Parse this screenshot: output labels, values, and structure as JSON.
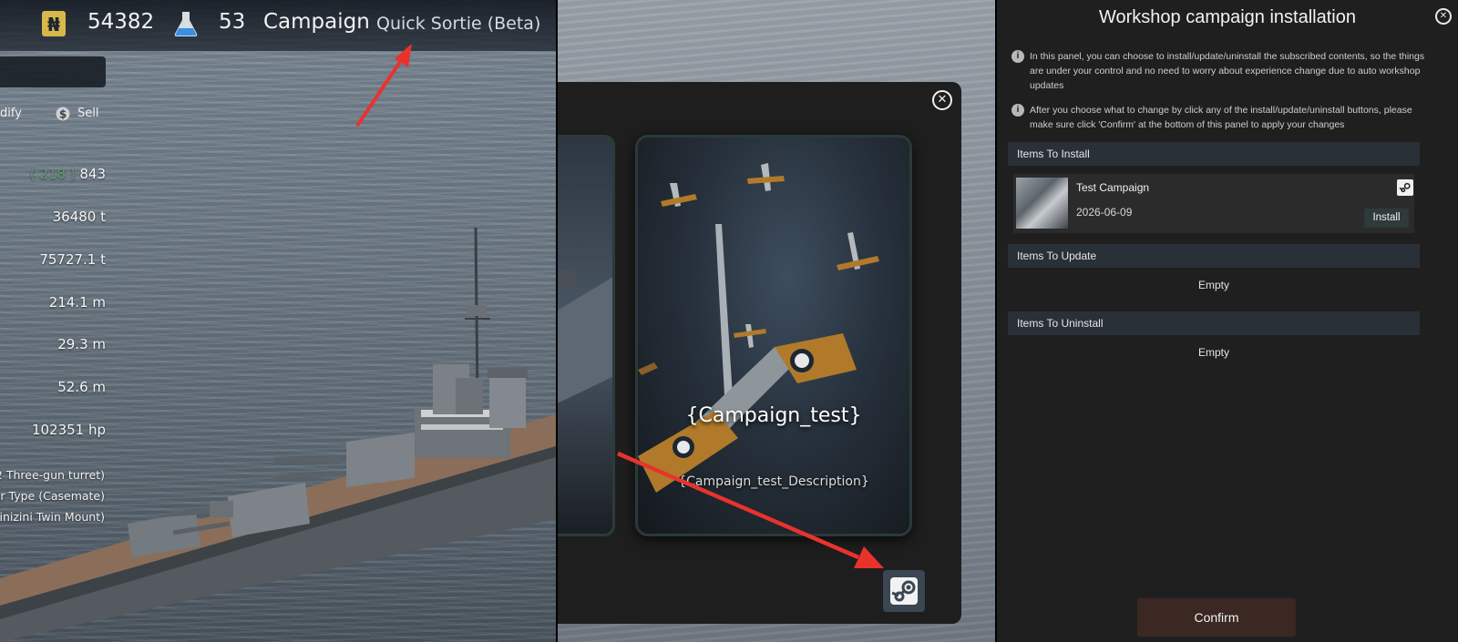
{
  "port": {
    "currency_value": "54382",
    "research_value": "53",
    "campaign_label": "Campaign",
    "quick_sortie_label": "Quick Sortie (Beta)",
    "modify_label": "dify",
    "sell_label": "Sell",
    "stats": {
      "bonus": "( 218 )",
      "s1": "843",
      "s2": "36480 t",
      "s3": "75727.1 t",
      "s4": "214.1 m",
      "s5": "29.3 m",
      "s6": "52.6 m",
      "s7": "102351 hp"
    },
    "weapons": [
      "2 Three-gun turret)",
      "ar Type (Casemate)",
      "inizini Twin Mount)"
    ]
  },
  "campaign_select": {
    "card_title": "{Campaign_test}",
    "card_description": "{Campaign_test_Description}"
  },
  "workshop": {
    "title": "Workshop campaign installation",
    "info_1": "In this panel, you can choose to install/update/uninstall the subscribed contents, so the things are under your control and no need to worry about experience change due to auto workshop updates",
    "info_2": "After you choose what to change by click any of the install/update/uninstall buttons, please make sure click 'Confirm' at the bottom of this panel to apply your changes",
    "sections": {
      "install": "Items To Install",
      "update": "Items To Update",
      "uninstall": "Items To Uninstall"
    },
    "item": {
      "name": "Test Campaign",
      "date": "2026-06-09",
      "install_label": "Install"
    },
    "update_empty": "Empty",
    "uninstall_empty": "Empty",
    "confirm_label": "Confirm"
  },
  "colors": {
    "arrow": "#e8332d",
    "bonus_green": "#5ea06a",
    "confirm_bg": "#3b2823"
  }
}
